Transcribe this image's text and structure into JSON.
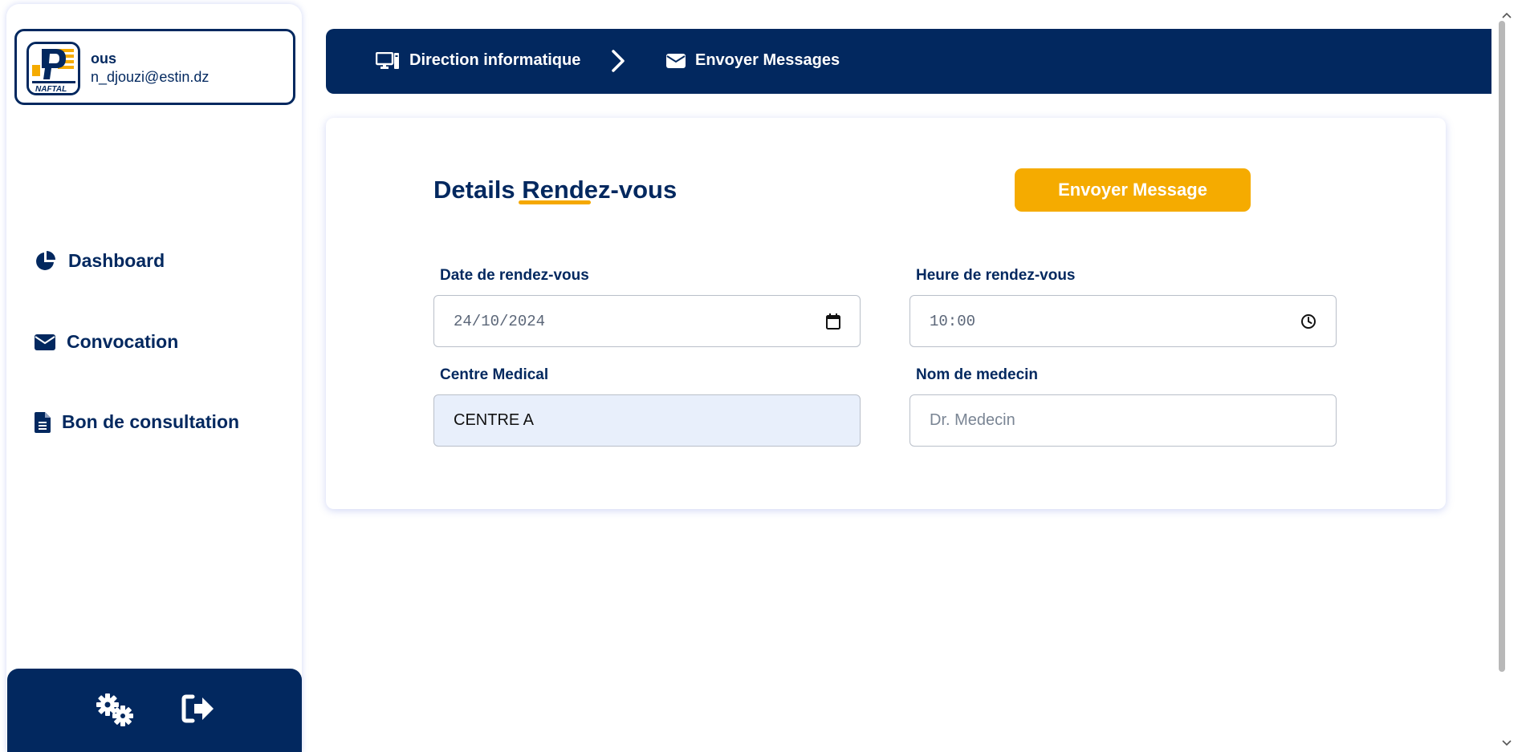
{
  "profile": {
    "name": "ous",
    "email": "n_djouzi@estin.dz",
    "logo_text": "NAFTAL"
  },
  "sidebar": {
    "items": [
      {
        "label": "Dashboard",
        "icon": "pie-chart-icon"
      },
      {
        "label": "Convocation",
        "icon": "envelope-icon"
      },
      {
        "label": "Bon de consultation",
        "icon": "document-icon"
      }
    ],
    "footer": {
      "settings_icon": "gears-icon",
      "logout_icon": "sign-out-icon"
    }
  },
  "breadcrumb": {
    "items": [
      {
        "label": "Direction informatique",
        "icon": "desktop-icon"
      },
      {
        "label": "Envoyer Messages",
        "icon": "envelope-icon"
      }
    ]
  },
  "card": {
    "title_prefix": "Details ",
    "title_highlight": "Rendez-vous",
    "send_button": "Envoyer Message",
    "fields": {
      "date": {
        "label": "Date de rendez-vous",
        "value": "24/10/2024"
      },
      "heure": {
        "label": "Heure de rendez-vous",
        "value": "10:00"
      },
      "centre": {
        "label": "Centre Medical",
        "value": "CENTRE A"
      },
      "nom": {
        "label": "Nom de medecin",
        "placeholder": "Dr. Medecin"
      }
    }
  },
  "colors": {
    "navy": "#02285f",
    "accent": "#f5ab00",
    "autofill_bg": "#e8effb"
  }
}
